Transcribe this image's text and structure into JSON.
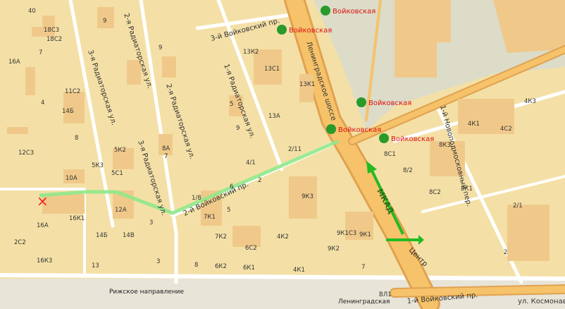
{
  "streets": {
    "voikovsky_3": "3-й Войковский пр.",
    "radiatorskaya_3_left": "3-я Радиаторская ул.",
    "radiatorskaya_2_top": "2-я Радиаторская ул.",
    "radiatorskaya_2": "2-я Радиаторская ул.",
    "radiatorskaya_3": "3-я Радиаторская ул.",
    "radiatorskaya_1": "1-я Радиаторская ул.",
    "leningradskoe": "Ленинградское шоссе",
    "voikovsky_2": "2-й Войковский пр.",
    "novopodmoskovny_1": "1-й Новоподмосковный пер.",
    "voikovsky_1": "1-й Войковский пр.",
    "kosmonavta": "ул. Космонав",
    "leningradskaya_bottom": "Ленинградская",
    "rizhskoe": "Рижское направление"
  },
  "metro": [
    {
      "label": "Войковская"
    },
    {
      "label": "Войковская"
    },
    {
      "label": "Войковская"
    },
    {
      "label": "Войковская"
    },
    {
      "label": "Войковская"
    }
  ],
  "highway": {
    "mkad": "МКАД",
    "center": "Центр"
  },
  "buildings": [
    "40",
    "9",
    "18С3",
    "18С2",
    "16A",
    "7",
    "11С2",
    "14Б",
    "4",
    "12С3",
    "8",
    "5К2",
    "5К3",
    "10A",
    "5С1",
    "12A",
    "16К1",
    "16A",
    "2С2",
    "16К3",
    "14Б",
    "14В",
    "3",
    "13",
    "9",
    "8A",
    "7",
    "1/8",
    "3",
    "8",
    "9",
    "2",
    "13К2",
    "13С1",
    "13К1",
    "5",
    "13A",
    "2/11",
    "4/1",
    "6",
    "7К1",
    "5",
    "7К2",
    "4К2",
    "6С2",
    "6К2",
    "6К1",
    "9К3",
    "9К1С3",
    "9К1",
    "9К2",
    "4К1",
    "7",
    "4К3",
    "8С1",
    "8К3",
    "4К1",
    "4С2",
    "8/2",
    "8С2",
    "8К1",
    "2/1",
    "2",
    "ВЛ1"
  ],
  "marker": {
    "label": "×"
  },
  "colors": {
    "route": "#8fe88a",
    "metro": "#d11",
    "road": "#f0a93a",
    "mkad_arrow": "#22bb22"
  }
}
